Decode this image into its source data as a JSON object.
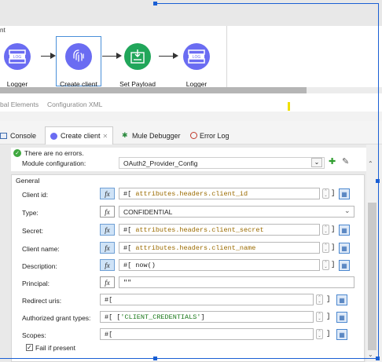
{
  "canvas": {
    "flow_label": "nt",
    "nodes": [
      {
        "label": "Logger",
        "icon": "log-icon"
      },
      {
        "label": "Create client",
        "icon": "fingerprint-icon"
      },
      {
        "label": "Set Payload",
        "icon": "set-payload-icon"
      },
      {
        "label": "Logger",
        "icon": "log-icon"
      }
    ]
  },
  "editor_tabs": {
    "global_elements": "bal Elements",
    "config_xml": "Configuration XML"
  },
  "view_tabs": {
    "console": "Console",
    "create_client": "Create client",
    "close": "✕",
    "mule_debugger": "Mule Debugger",
    "error_log": "Error Log"
  },
  "status": {
    "message": "There are no errors."
  },
  "module": {
    "label": "Module configuration:",
    "value": "OAuth2_Provider_Config"
  },
  "general": {
    "title": "General"
  },
  "fields": {
    "client_id": {
      "label": "Client id:",
      "prefix": "#[ ",
      "expr": "attributes.headers.client_id",
      "suffix": "]"
    },
    "type": {
      "label": "Type:",
      "value": "CONFIDENTIAL"
    },
    "secret": {
      "label": "Secret:",
      "prefix": "#[ ",
      "expr": "attributes.headers.client_secret",
      "suffix": "]"
    },
    "client_name": {
      "label": "Client name:",
      "prefix": "#[ ",
      "expr": "attributes.headers.client_name",
      "suffix": "]"
    },
    "description": {
      "label": "Description:",
      "value": "#[ now()"
    },
    "principal": {
      "label": "Principal:",
      "value": "\"\""
    },
    "redirect_uris": {
      "label": "Redirect uris:",
      "value": "#["
    },
    "grant_types": {
      "label": "Authorized grant types:",
      "prefix": "#[ [",
      "expr": "'CLIENT_CREDENTIALS'",
      "suffix": "]"
    },
    "scopes": {
      "label": "Scopes:",
      "value": "#["
    }
  },
  "fail_if_present": {
    "label": "Fail if present",
    "checked": true
  },
  "glyphs": {
    "fx": "fx",
    "bracket": "]",
    "check": "✓",
    "plus": "✚",
    "edit": "✎",
    "caret": "⌄"
  }
}
